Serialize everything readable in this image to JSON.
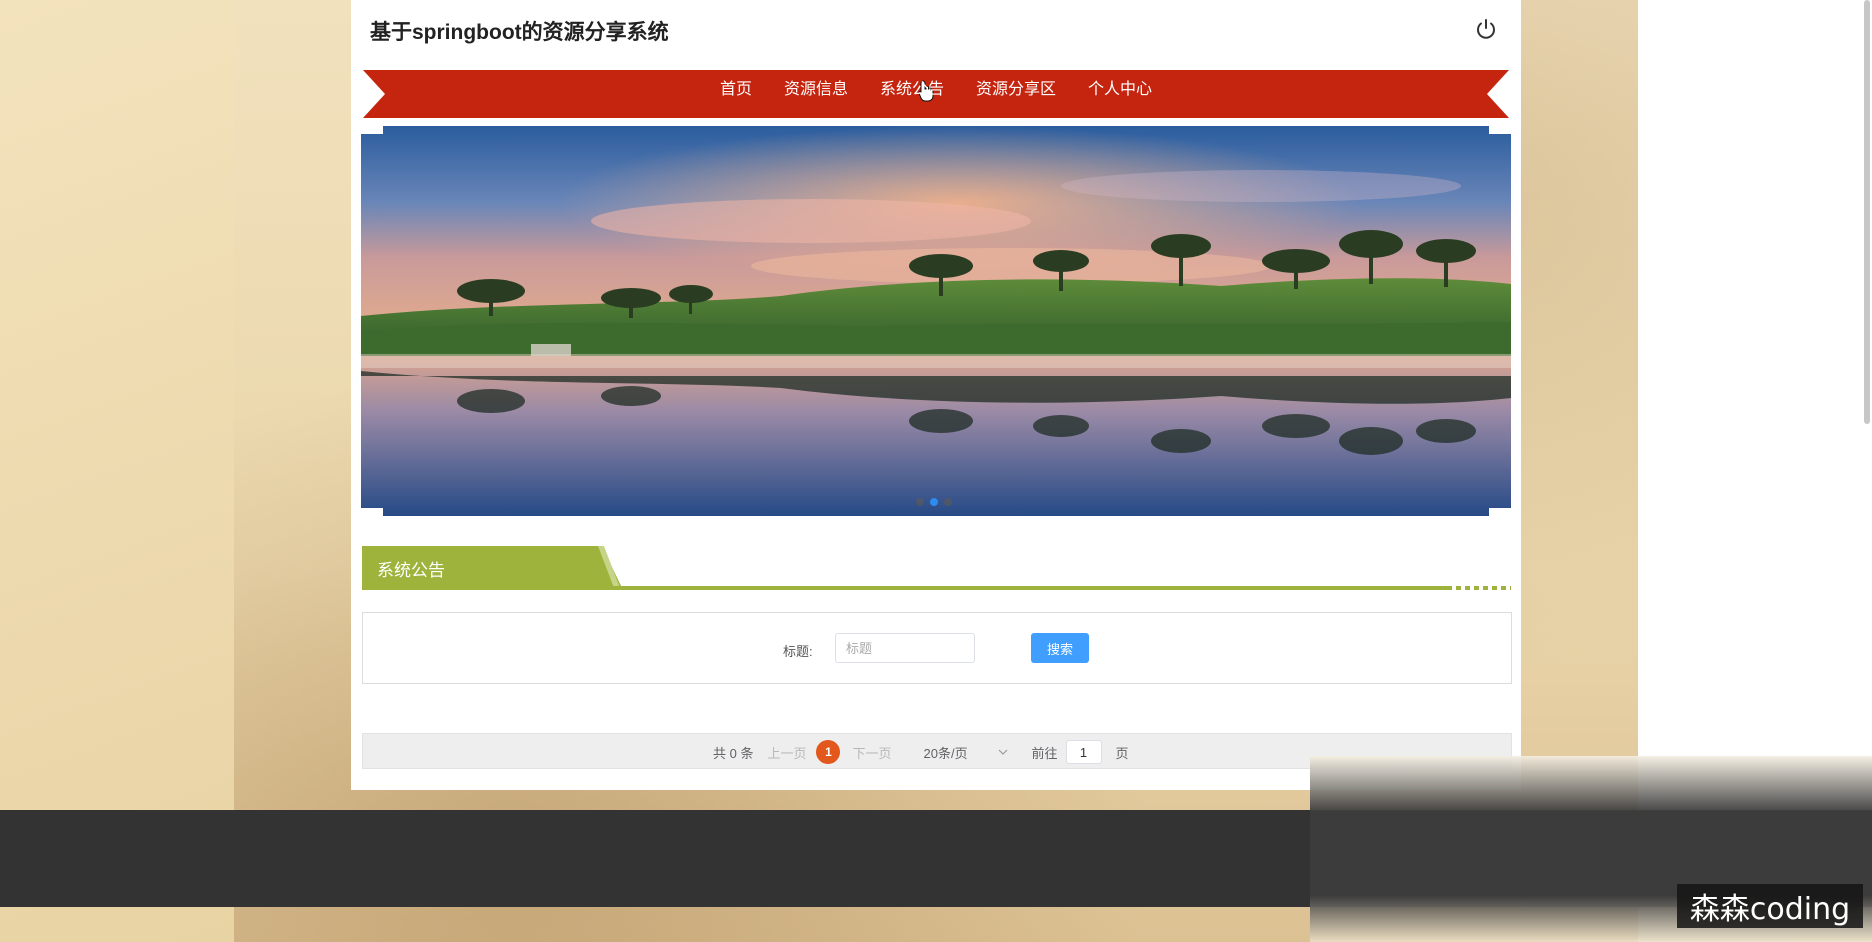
{
  "site": {
    "title": "基于springboot的资源分享系统"
  },
  "nav": {
    "items": [
      {
        "label": "首页"
      },
      {
        "label": "资源信息"
      },
      {
        "label": "系统公告"
      },
      {
        "label": "资源分享区"
      },
      {
        "label": "个人中心"
      }
    ],
    "active_index": 2
  },
  "carousel": {
    "slide_count": 3,
    "active_slide": 2
  },
  "section": {
    "title": "系统公告"
  },
  "search": {
    "label": "标题:",
    "placeholder": "标题",
    "button_label": "搜索"
  },
  "pagination": {
    "total_text": "共 0 条",
    "prev_label": "上一页",
    "current_page": "1",
    "next_label": "下一页",
    "page_size_label": "20条/页",
    "goto_label": "前往",
    "goto_value": "1",
    "page_suffix": "页"
  },
  "colors": {
    "nav_bg": "#c5250f",
    "section_accent": "#9db33b",
    "primary_button": "#409eff",
    "page_active": "#e2571c"
  },
  "watermark": {
    "text": "森森coding"
  }
}
